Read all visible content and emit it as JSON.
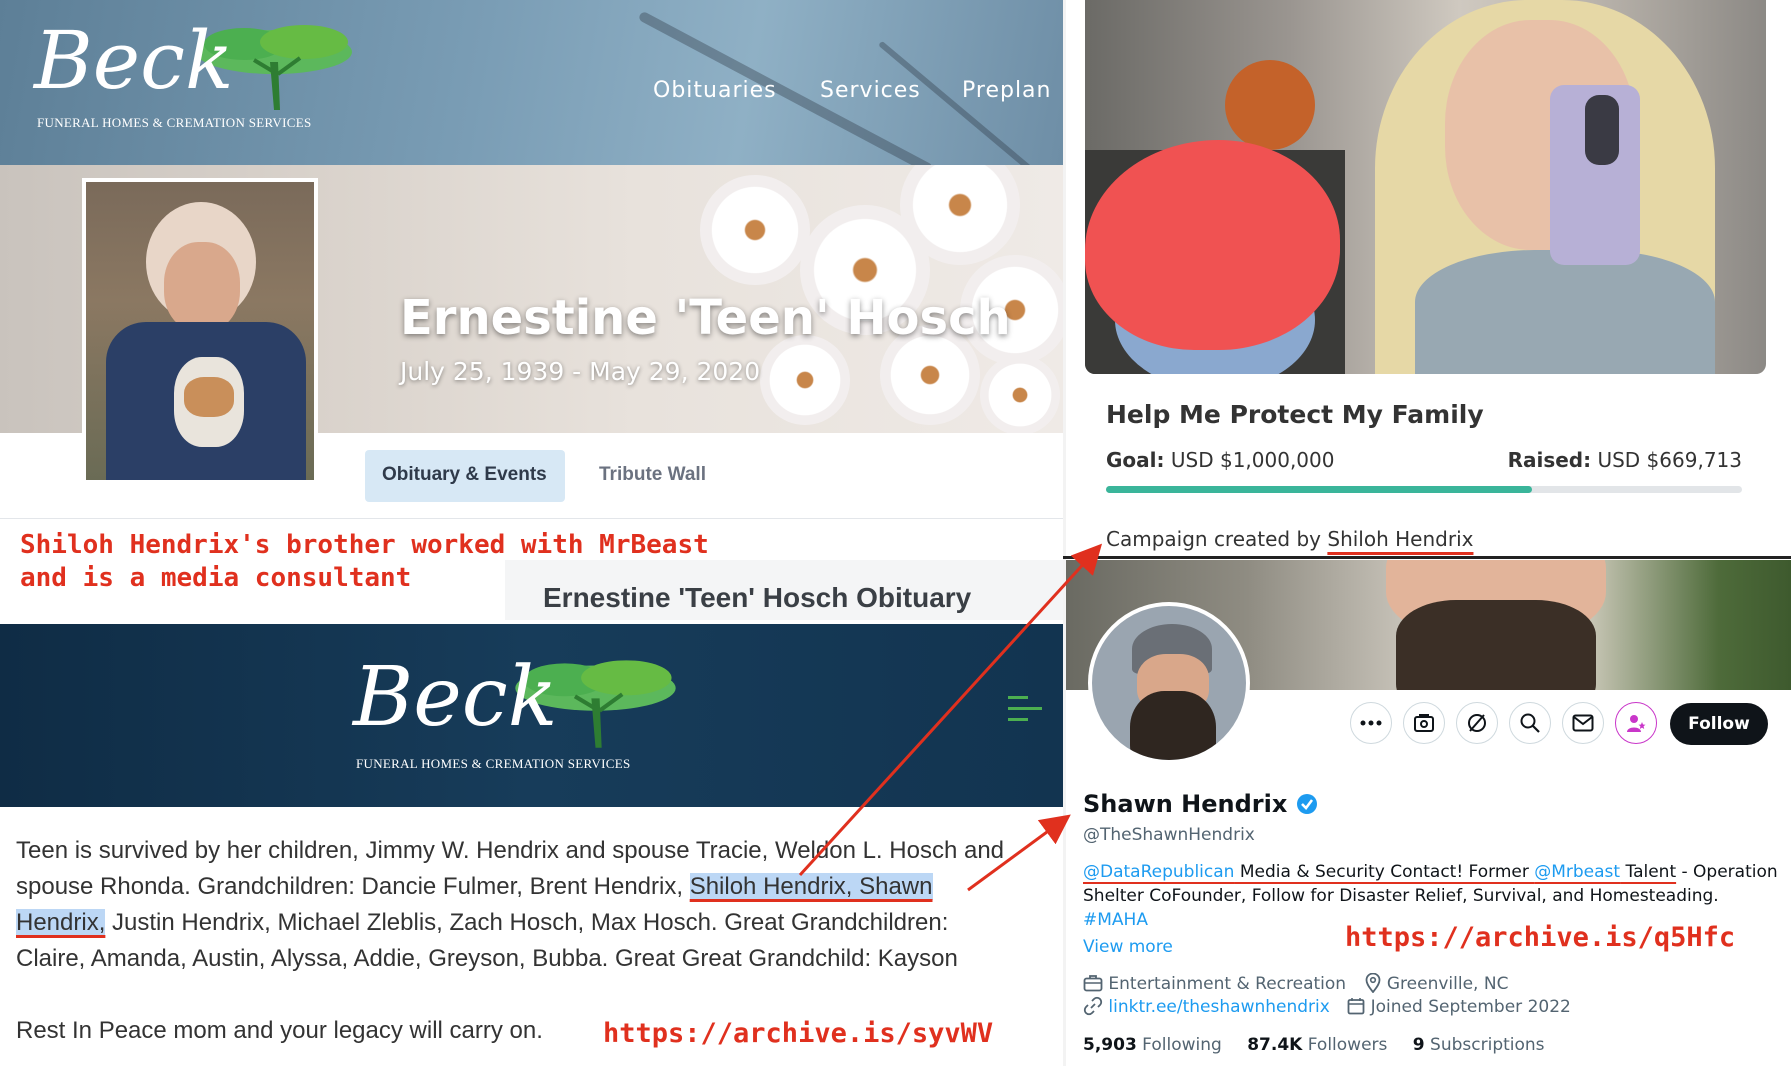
{
  "funeral_top": {
    "logo_script": "Beck",
    "logo_subtitle": "FUNERAL HOMES & CREMATION SERVICES",
    "nav": [
      "Obituaries",
      "Services",
      "Preplan"
    ],
    "hero_name": "Ernestine 'Teen' Hosch",
    "hero_dates": "July 25, 1939  -  May 29, 2020",
    "tabs": [
      "Obituary & Events",
      "Tribute Wall"
    ],
    "obituary_title": "Ernestine 'Teen' Hosch Obituary"
  },
  "annotation_left": {
    "line1": "Shiloh Hendrix's brother worked with MrBeast",
    "line2": "and is a media consultant"
  },
  "funeral_bottom": {
    "logo_script": "Beck",
    "logo_subtitle": "FUNERAL HOMES & CREMATION SERVICES",
    "para_line1": "Teen is survived by her children, Jimmy W. Hendrix and spouse Tracie, Weldon L. Hosch and",
    "para_line2_a": "spouse Rhonda. Grandchildren: Dancie Fulmer, Brent Hendrix, ",
    "para_line2_hl": "Shiloh Hendrix, Shawn",
    "para_line3_hl": "Hendrix,",
    "para_line3_b": " Justin Hendrix, Michael Zleblis, Zach Hosch, Max Hosch. Great Grandchildren:",
    "para_line4": "Claire, Amanda, Austin, Alyssa, Addie, Greyson, Bubba. Great Great Grandchild: Kayson",
    "rest_line": "Rest In Peace mom and your legacy will carry on.",
    "archive_link": "https://archive.is/syvWV"
  },
  "fundraiser": {
    "title": "Help Me Protect My Family",
    "goal_label": "Goal:",
    "goal_value": "USD $1,000,000",
    "raised_label": "Raised:",
    "raised_value": "USD $669,713",
    "progress": 0.67,
    "created_by_label": "Campaign created by ",
    "created_by_name": "Shiloh Hendrix"
  },
  "profile": {
    "display_name": "Shawn Hendrix",
    "handle": "@TheShawnHendrix",
    "follow_label": "Follow",
    "bio_mention1": "@DataRepublican",
    "bio_text1": " Media & Security Contact! Former ",
    "bio_mention2": "@Mrbeast",
    "bio_talent": " Talent",
    "bio_text2": " - Operation",
    "bio_line2": "Shelter CoFounder,  Follow for Disaster Relief, Survival, and Homesteading.",
    "bio_hashtag": "#MAHA",
    "view_more": "View more",
    "archive_link": "https://archive.is/q5Hfc",
    "category": "Entertainment & Recreation",
    "location": "Greenville, NC",
    "website": "linktr.ee/theshawnhendrix",
    "joined": "Joined September 2022",
    "following_count": "5,903",
    "following_label": " Following",
    "followers_count": "87.4K",
    "followers_label": " Followers",
    "subs_count": "9",
    "subs_label": " Subscriptions"
  },
  "colors": {
    "annotation_red": "#e0301e",
    "progress_fill": "#3ab59a",
    "x_link": "#1d9bf0",
    "verified": "#1d9bf0",
    "highlight": "#bcd7f5"
  }
}
